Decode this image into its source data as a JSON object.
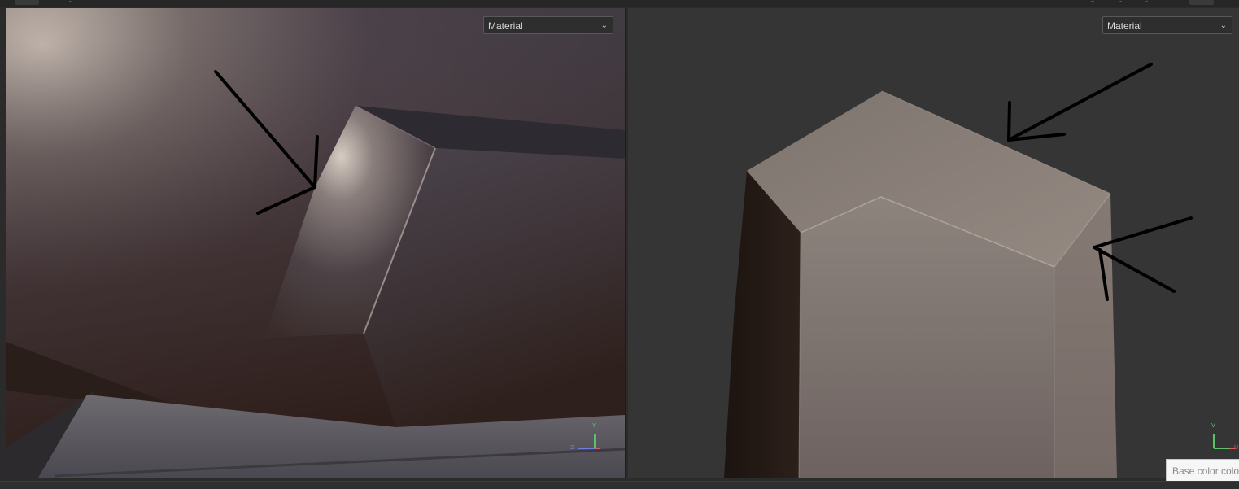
{
  "left_viewport": {
    "shading_dropdown": {
      "value": "Material"
    },
    "axis_gizmo": {
      "y_label": "Y",
      "z_label": "Z"
    }
  },
  "right_viewport": {
    "shading_dropdown": {
      "value": "Material"
    },
    "axis_gizmo": {
      "v_label": "V",
      "u_label": "U"
    }
  },
  "tooltip": {
    "text": "Base color color"
  },
  "colors": {
    "panel_bg": "#2b2b2b",
    "viewport_bg": "#353535",
    "dropdown_bg": "#2e2e2e",
    "axis_y": "#5fc06a",
    "axis_z": "#6a7fe0",
    "axis_u": "#e05a5a",
    "annotation_ink": "#000000"
  },
  "icons": [
    "chevron-down-icon",
    "axis-gizmo-icon",
    "arrow-annotation-icon"
  ]
}
